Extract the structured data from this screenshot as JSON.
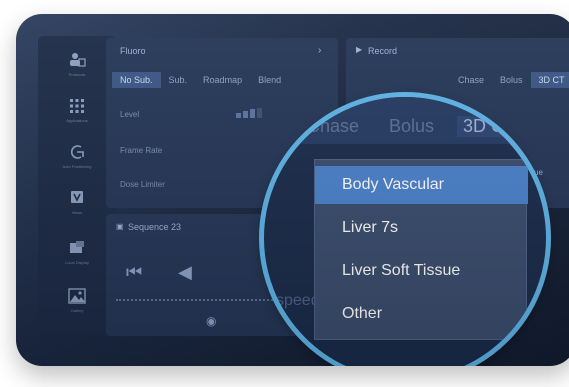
{
  "left_nav": [
    {
      "label": "Protocols",
      "icon": "protocols-icon"
    },
    {
      "label": "Applications",
      "icon": "apps-grid-icon"
    },
    {
      "label": "Auto Positioning",
      "icon": "positioning-icon"
    },
    {
      "label": "Views",
      "icon": "views-icon"
    },
    {
      "label": "Local Display",
      "icon": "display-icon"
    },
    {
      "label": "Gallery",
      "icon": "gallery-icon"
    }
  ],
  "fluoro": {
    "title": "Fluoro",
    "tabs": [
      "No Sub.",
      "Sub.",
      "Roadmap",
      "Blend"
    ],
    "rows": [
      "Level",
      "Frame Rate",
      "Dose Limiter"
    ]
  },
  "record": {
    "title": "Record",
    "tabs": [
      "Chase",
      "Bolus",
      "3D CT"
    ],
    "selected_chip": "Vascular",
    "side_text": "ue"
  },
  "sequence": {
    "title": "Sequence 23",
    "speed_label": "speed"
  },
  "magnifier": {
    "tabs": [
      "Chase",
      "Bolus",
      "3D CT"
    ],
    "chip": "Vascular",
    "menu": [
      "Body Vascular",
      "Liver 7s",
      "Liver Soft Tissue",
      "Other"
    ],
    "selected_index": 0
  },
  "colors": {
    "accent": "#4a82cc",
    "ring": "#5eb4e8",
    "background": "#1b2944"
  }
}
